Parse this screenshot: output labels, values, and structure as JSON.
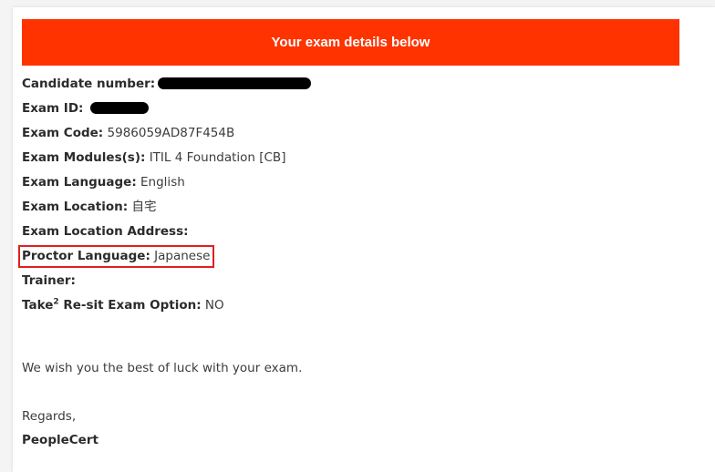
{
  "banner": {
    "title": "Your exam details below"
  },
  "details": {
    "candidate_label": "Candidate number:",
    "exam_id_label": "Exam ID:",
    "exam_code_label": "Exam Code:",
    "exam_code_value": "5986059AD87F454B",
    "modules_label": "Exam Modules(s):",
    "modules_value": "ITIL 4 Foundation [CB]",
    "language_label": "Exam Language:",
    "language_value": "English",
    "location_label": "Exam Location:",
    "location_value": "自宅",
    "address_label": "Exam Location Address:",
    "proctor_label": "Proctor Language:",
    "proctor_value": "Japanese",
    "trainer_label": "Trainer:",
    "resit_label_pre": "Take",
    "resit_sup": "2",
    "resit_label_post": " Re-sit Exam Option:",
    "resit_value": "NO"
  },
  "message": {
    "good_luck": "We wish you the best of luck with your exam.",
    "regards": "Regards,",
    "signature": "PeopleCert"
  },
  "colors": {
    "banner_bg": "#ff3300",
    "highlight_border": "#e02020",
    "redaction": "#000000"
  }
}
